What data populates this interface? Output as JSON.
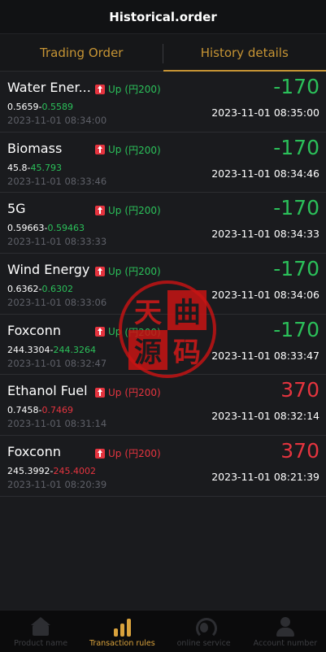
{
  "header": {
    "title": "Historical.order"
  },
  "tabs": [
    {
      "label": "Trading Order",
      "active": false
    },
    {
      "label": "History details",
      "active": true
    }
  ],
  "orders": [
    {
      "name": "Water Ener...",
      "direction": "Up",
      "amount": "(円200)",
      "open_price": "0.5659",
      "close_price": "0.5589",
      "open_time": "2023-11-01 08:34:00",
      "profit_loss": "-170",
      "close_time": "2023-11-01 08:35:00",
      "color": "green"
    },
    {
      "name": "Biomass",
      "direction": "Up",
      "amount": "(円200)",
      "open_price": "45.8",
      "close_price": "45.793",
      "open_time": "2023-11-01 08:33:46",
      "profit_loss": "-170",
      "close_time": "2023-11-01 08:34:46",
      "color": "green"
    },
    {
      "name": "5G",
      "direction": "Up",
      "amount": "(円200)",
      "open_price": "0.59663",
      "close_price": "0.59463",
      "open_time": "2023-11-01 08:33:33",
      "profit_loss": "-170",
      "close_time": "2023-11-01 08:34:33",
      "color": "green"
    },
    {
      "name": "Wind Energy",
      "direction": "Up",
      "amount": "(円200)",
      "open_price": "0.6362",
      "close_price": "0.6302",
      "open_time": "2023-11-01 08:33:06",
      "profit_loss": "-170",
      "close_time": "2023-11-01 08:34:06",
      "color": "green"
    },
    {
      "name": "Foxconn",
      "direction": "Up",
      "amount": "(円200)",
      "open_price": "244.3304",
      "close_price": "244.3264",
      "open_time": "2023-11-01 08:32:47",
      "profit_loss": "-170",
      "close_time": "2023-11-01 08:33:47",
      "color": "green"
    },
    {
      "name": "Ethanol Fuel",
      "direction": "Up",
      "amount": "(円200)",
      "open_price": "0.7458",
      "close_price": "0.7469",
      "open_time": "2023-11-01 08:31:14",
      "profit_loss": "370",
      "close_time": "2023-11-01 08:32:14",
      "color": "red"
    },
    {
      "name": "Foxconn",
      "direction": "Up",
      "amount": "(円200)",
      "open_price": "245.3992",
      "close_price": "245.4002",
      "open_time": "2023-11-01 08:20:39",
      "profit_loss": "370",
      "close_time": "2023-11-01 08:21:39",
      "color": "red"
    }
  ],
  "stamp": {
    "chars": [
      "天",
      "曲",
      "源",
      "码"
    ]
  },
  "bottom_nav": [
    {
      "label": "Product name",
      "icon": "home-icon",
      "active": false
    },
    {
      "label": "Transaction rules",
      "icon": "bar-chart-icon",
      "active": true
    },
    {
      "label": "online service",
      "icon": "headset-icon",
      "active": false
    },
    {
      "label": "Account number",
      "icon": "user-icon",
      "active": false
    }
  ],
  "colors": {
    "accent": "#c69434",
    "gain": "#2bc05a",
    "loss": "#e5343f",
    "background": "#1a1b1e"
  }
}
